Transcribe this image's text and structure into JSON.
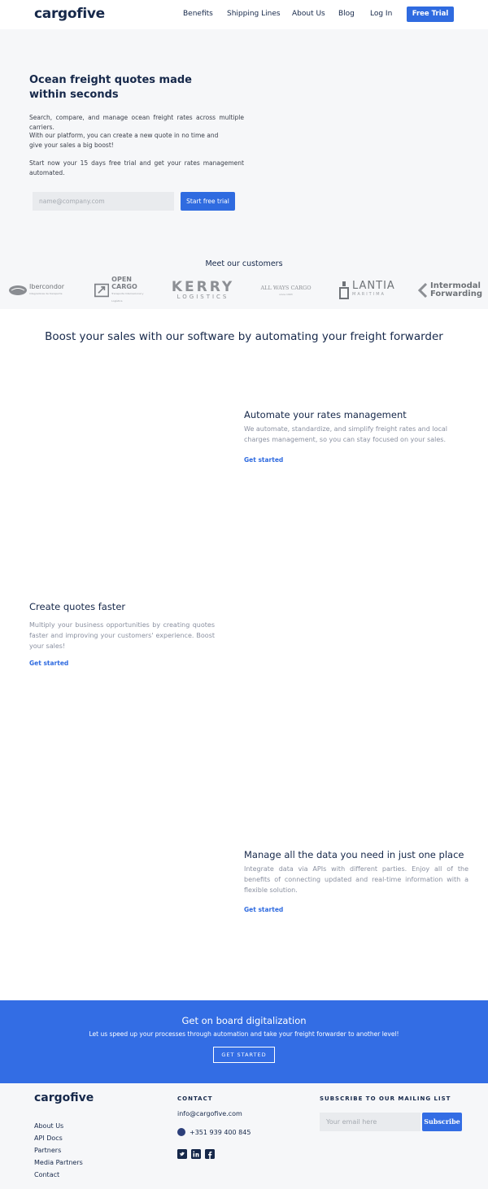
{
  "nav": {
    "logo": "cargofive",
    "links": [
      "Benefits",
      "Shipping Lines",
      "About Us",
      "Blog",
      "Log In"
    ],
    "cta": "Free Trial"
  },
  "hero": {
    "title": "Ocean freight quotes made within seconds",
    "p1": "Search, compare, and manage ocean freight rates across multiple carriers.",
    "p2": "With our platform, you can create a new quote in no time and give your sales a big boost!",
    "p3": "Start now your 15 days free trial and get your rates management automated.",
    "email_placeholder": "name@company.com",
    "button": "Start free trial"
  },
  "customers": {
    "title": "Meet our customers",
    "logos": [
      {
        "name": "Ibercondor",
        "sub": "Integradores de transporte"
      },
      {
        "name": "OPEN CARGO",
        "sub": "Transporte Internacional y Logística"
      },
      {
        "name": "KERRY",
        "sub": "LOGISTICS"
      },
      {
        "name": "ALL WAYS CARGO",
        "sub": "since 1993"
      },
      {
        "name": "LANTIA",
        "sub": "MARITIMA"
      },
      {
        "name": "Intermodal",
        "sub": "Forwarding"
      }
    ]
  },
  "features": {
    "heading": "Boost your sales with our software by automating your freight forwarder",
    "items": [
      {
        "title": "Automate your rates management",
        "text": "We automate, standardize, and simplify freight rates and local charges management, so you can stay focused on your sales.",
        "link": "Get started"
      },
      {
        "title": "Create quotes faster",
        "text": "Multiply your business opportunities by creating quotes faster and improving your customers' experience. Boost your sales!",
        "link": "Get started"
      },
      {
        "title": "Manage all the data you need in just one place",
        "text": "Integrate data via APIs with different parties. Enjoy all of the benefits of connecting updated and real-time information with a flexible solution.",
        "link": "Get started"
      }
    ]
  },
  "band": {
    "title": "Get on board digitalization",
    "subtitle": "Let us speed up your processes through automation and take your freight forwarder to another level!",
    "button": "GET STARTED"
  },
  "footer": {
    "logo": "cargofive",
    "links": [
      "About Us",
      "API Docs",
      "Partners",
      "Media Partners",
      "Contact"
    ],
    "contact_heading": "CONTACT",
    "email": "info@cargofive.com",
    "phone": "+351 939 400 845",
    "social": [
      "twitter-icon",
      "linkedin-icon",
      "facebook-icon"
    ],
    "subscribe_heading": "SUBSCRIBE TO OUR MAILING LIST",
    "subscribe_placeholder": "Your email here",
    "subscribe_button": "Subscribe"
  },
  "colors": {
    "primary": "#2f6be0",
    "navy": "#16284a",
    "light_bg": "#f6f7f9"
  }
}
